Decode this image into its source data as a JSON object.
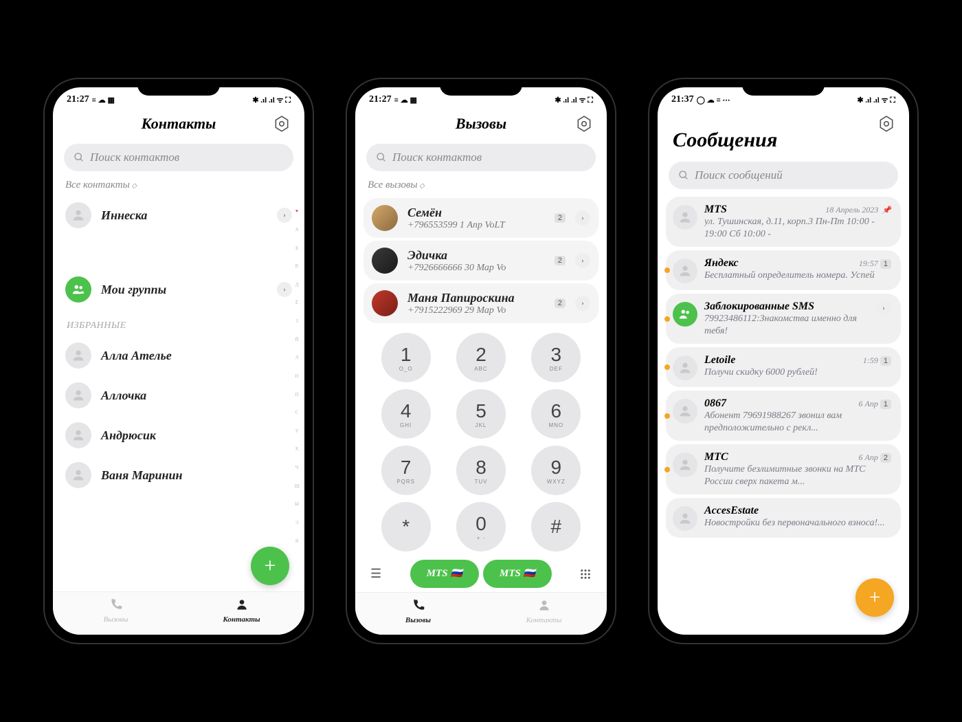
{
  "phone1": {
    "status_time": "21:27",
    "title": "Контакты",
    "search_ph": "Поиск контактов",
    "filter": "Все контакты",
    "contact1": "Иннеска",
    "groups": "Мои группы",
    "fav_header": "ИЗБРАННЫЕ",
    "fav": [
      "Алла Ателье",
      "Аллочка",
      "Андрюсик",
      "Ваня Маринин"
    ],
    "tab_calls": "Вызовы",
    "tab_contacts": "Контакты",
    "az": [
      "♥",
      "А",
      "Б",
      "В",
      "Д",
      "Ё",
      "З",
      "Й",
      "Л",
      "Н",
      "П",
      "С",
      "У",
      "Х",
      "Ч",
      "Щ",
      "Ы",
      "Э",
      "Я"
    ]
  },
  "phone2": {
    "status_time": "21:27",
    "title": "Вызовы",
    "search_ph": "Поиск контактов",
    "filter": "Все вызовы",
    "calls": [
      {
        "name": "Семён",
        "sub": "+796553599 1 Апр  VoLT",
        "badge": "2"
      },
      {
        "name": "Эдичка",
        "sub": "+7926666666 30 Мар  Vo",
        "badge": "2"
      },
      {
        "name": "Маня Папироскина",
        "sub": "+7915222969 29 Мар  Vo",
        "badge": "2"
      }
    ],
    "keys": [
      {
        "n": "1",
        "l": "O_O"
      },
      {
        "n": "2",
        "l": "ABC"
      },
      {
        "n": "3",
        "l": "DEF"
      },
      {
        "n": "4",
        "l": "GHI"
      },
      {
        "n": "5",
        "l": "JKL"
      },
      {
        "n": "6",
        "l": "MNO"
      },
      {
        "n": "7",
        "l": "PQRS"
      },
      {
        "n": "8",
        "l": "TUV"
      },
      {
        "n": "9",
        "l": "WXYZ"
      },
      {
        "n": "*",
        "l": ""
      },
      {
        "n": "0",
        "l": "+  -"
      },
      {
        "n": "#",
        "l": ""
      }
    ],
    "sim1": "MTS",
    "sim2": "MTS",
    "tab_calls": "Вызовы",
    "tab_contacts": "Контакты"
  },
  "phone3": {
    "status_time": "21:37",
    "title": "Сообщения",
    "search_ph": "Поиск сообщений",
    "msgs": [
      {
        "name": "MTS",
        "date": "18 Апрель 2023",
        "prev": "ул. Тушинская, д.11, корп.3 Пн-Пт 10:00 - 19:00 Сб 10:00 -",
        "pinned": true,
        "unread": false,
        "badge": ""
      },
      {
        "name": "Яндекс",
        "date": "19:57",
        "prev": "Бесплатный определитель номера. Успей",
        "unread": true,
        "badge": "1"
      },
      {
        "name": "Заблокированные SMS",
        "date": "",
        "prev": "79923486112:Знакомства именно для тебя!",
        "unread": true,
        "grn": true,
        "chev": true
      },
      {
        "name": "Letoile",
        "date": "1:59",
        "prev": "Получи скидку 6000 рублей!",
        "unread": true,
        "badge": "1"
      },
      {
        "name": "0867",
        "date": "6 Апр",
        "prev": "Абонент 79691988267 звонил вам предположительно с рекл...",
        "unread": true,
        "badge": "1"
      },
      {
        "name": "МТС",
        "date": "6 Апр",
        "prev": "Получите безлимитные звонки на МТС России сверх пакета м...",
        "unread": true,
        "badge": "2"
      },
      {
        "name": "AccesEstate",
        "date": "",
        "prev": "Новостройки без первоначального взноса!...",
        "unread": false
      }
    ]
  }
}
